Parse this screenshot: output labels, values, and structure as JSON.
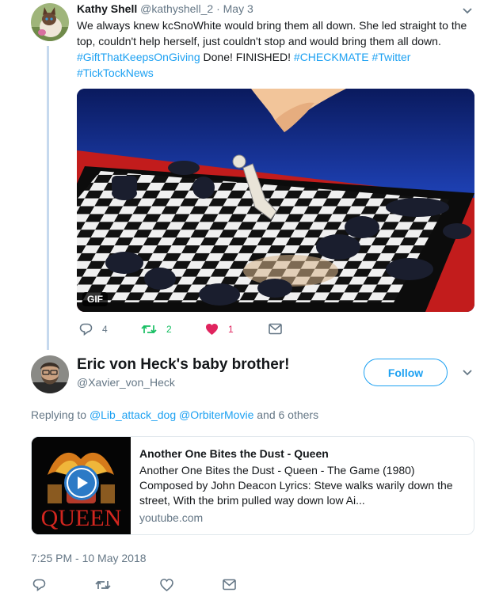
{
  "tweet": {
    "author_name": "Kathy Shell",
    "author_handle": "@kathyshell_2",
    "separator": "·",
    "date": "May 3",
    "text_main": "We always knew kcSnoWhite would bring them all down. She led straight to the top, couldn't help herself, just couldn't stop and would bring them all down.",
    "hashtag_1": "#GiftThatKeepsOnGiving",
    "text_mid": "Done! FINISHED!",
    "hashtag_2": "#CHECKMATE",
    "hashtag_3": "#Twitter",
    "hashtag_4": "#TickTockNews",
    "media_badge": "GIF",
    "reply_count": "4",
    "retweet_count": "2",
    "like_count": "1"
  },
  "reply": {
    "author_name": "Eric von Heck's baby brother!",
    "author_handle": "@Xavier_von_Heck",
    "follow_label": "Follow",
    "replying_prefix": "Replying to",
    "mention_1": "@Lib_attack_dog",
    "mention_2": "@OrbiterMovie",
    "replying_suffix": "and 6 others",
    "card": {
      "title": "Another One Bites the Dust - Queen",
      "description": "Another One Bites the Dust - Queen - The Game (1980) Composed by John Deacon Lyrics: Steve walks warily down the street, With the brim pulled way down low Ai...",
      "domain": "youtube.com",
      "thumb_text": "QUEEN"
    },
    "timestamp": "7:25 PM - 10 May 2018"
  },
  "colors": {
    "accent": "#1da1f2",
    "retweet": "#17bf63",
    "like": "#e0245e",
    "muted": "#657786"
  },
  "icons": [
    "chevron-down-icon",
    "reply-icon",
    "retweet-icon",
    "heart-icon",
    "message-icon",
    "play-icon"
  ]
}
